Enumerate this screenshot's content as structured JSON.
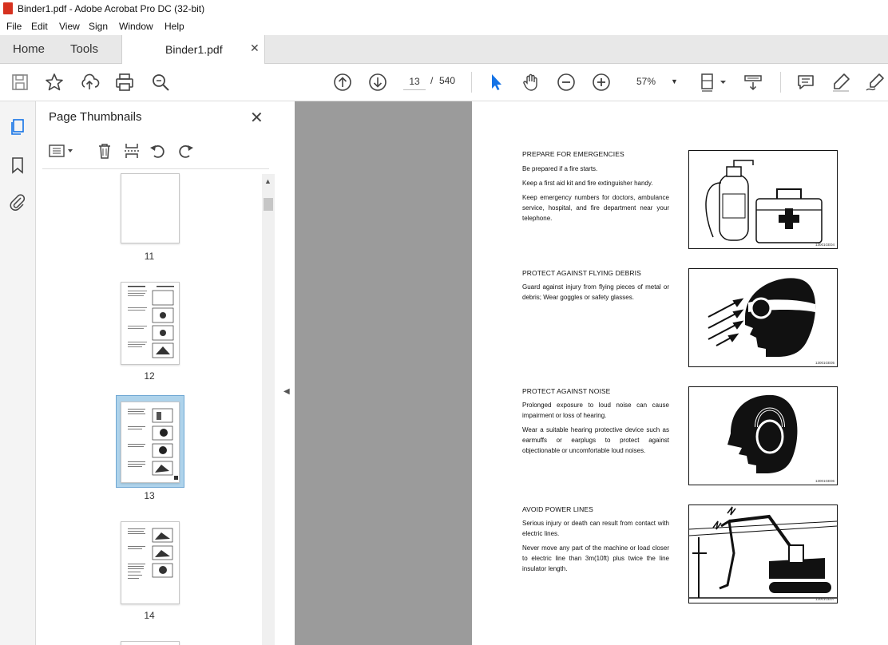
{
  "window": {
    "title": "Binder1.pdf - Adobe Acrobat Pro DC (32-bit)"
  },
  "menu": [
    "File",
    "Edit",
    "View",
    "Sign",
    "Window",
    "Help"
  ],
  "tabs": {
    "home": "Home",
    "tools": "Tools",
    "document": "Binder1.pdf"
  },
  "toolbar": {
    "current_page": "13",
    "page_sep": "/",
    "total_pages": "540",
    "zoom": "57%"
  },
  "panel": {
    "title": "Page Thumbnails",
    "thumbnails": [
      {
        "label": "11"
      },
      {
        "label": "12"
      },
      {
        "label": "13"
      },
      {
        "label": "14"
      }
    ]
  },
  "document": {
    "sections": [
      {
        "title": "PREPARE FOR EMERGENCIES",
        "paragraphs": [
          "Be prepared if a fire starts.",
          "Keep a first aid kit and fire extinguisher handy.",
          "Keep emergency numbers for doctors, ambulance service, hospital, and fire department near your telephone."
        ],
        "code": "13001GE04"
      },
      {
        "title": "PROTECT AGAINST FLYING DEBRIS",
        "paragraphs": [
          "Guard against injury  from flying pieces of metal or debris; Wear goggles or safety glasses."
        ],
        "code": "13001GE05"
      },
      {
        "title": "PROTECT AGAINST NOISE",
        "paragraphs": [
          "Prolonged exposure to loud noise can cause impairment or loss of hearing.",
          "Wear a suitable hearing protective device such as earmuffs or earplugs to protect against objectionable or uncomfortable loud noises."
        ],
        "code": "13001GE06"
      },
      {
        "title": "AVOID POWER LINES",
        "paragraphs": [
          "Serious injury or death can result from contact with electric lines.",
          "Never move any part of the machine or load closer to electric line than 3m(10ft) plus twice the line insulator length."
        ],
        "code": "13001GE07"
      }
    ]
  },
  "icons": [
    "save-icon",
    "star-icon",
    "upload-icon",
    "print-icon",
    "search-icon",
    "page-up-icon",
    "page-down-icon",
    "select-cursor-icon",
    "hand-icon",
    "zoom-out-icon",
    "zoom-in-icon",
    "fit-page-icon",
    "scroll-mode-icon",
    "comment-icon",
    "highlight-icon",
    "sign-icon"
  ],
  "colors": {
    "accent": "#1473e6",
    "selection": "#aed3eb",
    "viewer_bg": "#9b9b9b",
    "pdf_icon": "#d6311f"
  }
}
